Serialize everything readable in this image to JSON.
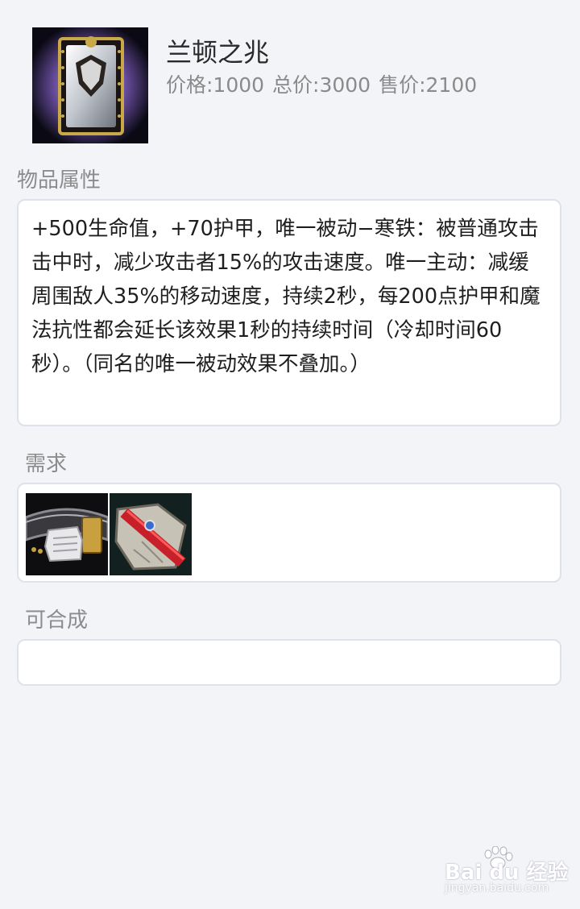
{
  "item": {
    "name": "兰顿之兆",
    "price": "价格:1000",
    "total_price": "总价:3000",
    "sell_price": "售价:2100",
    "icon": "randuins-omen-icon"
  },
  "sections": {
    "attributes_title": "物品属性",
    "requirements_title": "需求",
    "builds_into_title": "可合成"
  },
  "description": "+500生命值，+70护甲，唯一被动−寒铁：被普通攻击击中时，减少攻击者15%的攻击速度。唯一主动：减缓周围敌人35%的移动速度，持续2秒，每200点护甲和魔法抗性都会延长该效果1秒的持续时间（冷却时间60秒）。（同名的唯一被动效果不叠加。）",
  "requirements": [
    {
      "icon": "giants-belt-icon"
    },
    {
      "icon": "warden-mail-icon"
    }
  ],
  "builds_into": [],
  "watermark": {
    "main": "Bai du 经验",
    "sub": "jingyan.baidu.com"
  }
}
